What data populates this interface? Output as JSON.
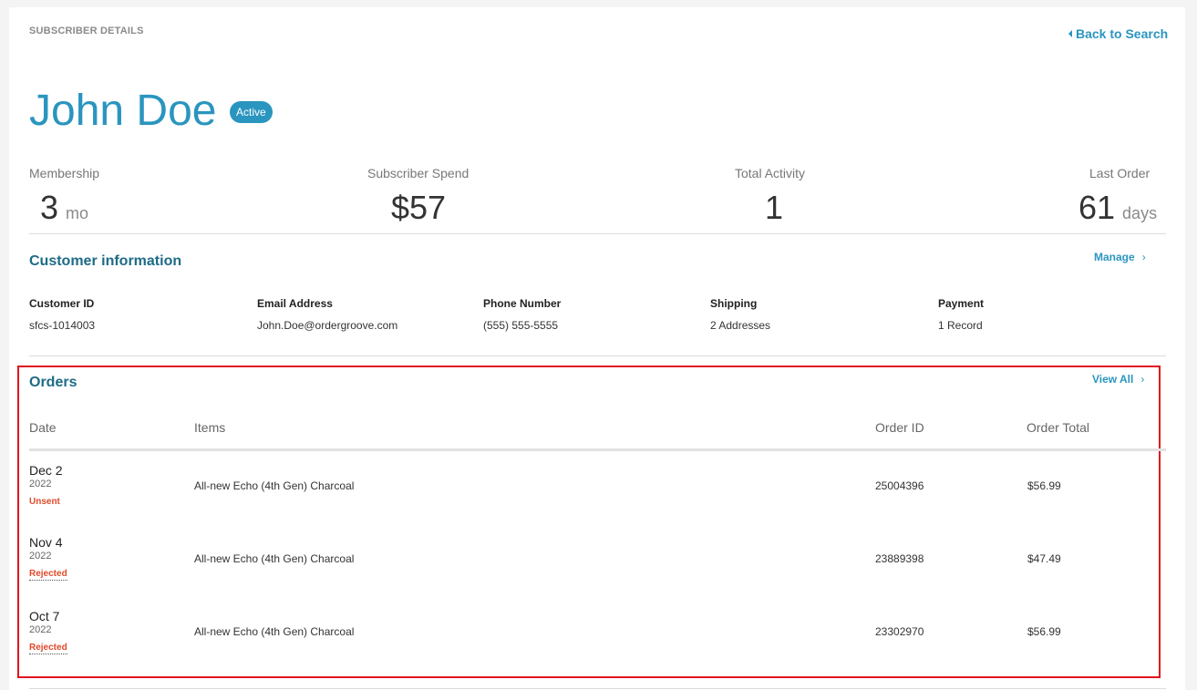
{
  "header": {
    "eyebrow": "SUBSCRIBER DETAILS",
    "back_link": "Back to Search",
    "name": "John Doe",
    "status_badge": "Active"
  },
  "stats": [
    {
      "label": "Membership",
      "value": "3",
      "unit": "mo"
    },
    {
      "label": "Subscriber Spend",
      "value": "$57",
      "unit": ""
    },
    {
      "label": "Total Activity",
      "value": "1",
      "unit": ""
    },
    {
      "label": "Last Order",
      "value": "61",
      "unit": "days"
    }
  ],
  "customer_info": {
    "title": "Customer information",
    "manage_link": "Manage",
    "fields": [
      {
        "label": "Customer ID",
        "value": "sfcs-1014003"
      },
      {
        "label": "Email Address",
        "value": "John.Doe@ordergroove.com"
      },
      {
        "label": "Phone Number",
        "value": "(555) 555-5555"
      },
      {
        "label": "Shipping",
        "value": "2 Addresses"
      },
      {
        "label": "Payment",
        "value": "1 Record"
      }
    ]
  },
  "orders": {
    "title": "Orders",
    "view_all_link": "View All",
    "columns": [
      "Date",
      "Items",
      "Order ID",
      "Order Total"
    ],
    "rows": [
      {
        "date": "Dec 2",
        "year": "2022",
        "status": "Unsent",
        "item": "All-new Echo (4th Gen) Charcoal",
        "order_id": "25004396",
        "total": "$56.99"
      },
      {
        "date": "Nov 4",
        "year": "2022",
        "status": "Rejected",
        "item": "All-new Echo (4th Gen) Charcoal",
        "order_id": "23889398",
        "total": "$47.49"
      },
      {
        "date": "Oct 7",
        "year": "2022",
        "status": "Rejected",
        "item": "All-new Echo (4th Gen) Charcoal",
        "order_id": "23302970",
        "total": "$56.99"
      }
    ]
  },
  "colors": {
    "accent": "#2a95bf",
    "section_title": "#1d6b86",
    "status_red": "#e04a2a",
    "highlight_box": "#e0141e"
  },
  "icons": {
    "back": "caret-left-icon",
    "chevron": "chevron-right-icon"
  }
}
